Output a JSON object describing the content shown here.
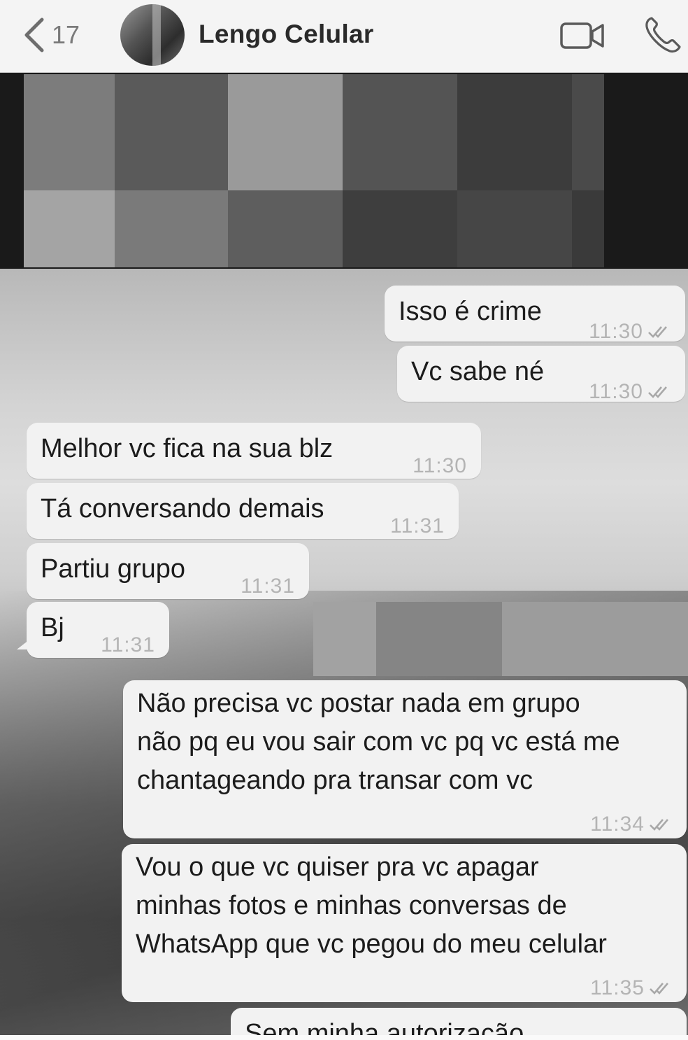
{
  "header": {
    "back_count": "17",
    "contact_name": "Lengo Celular"
  },
  "messages": [
    {
      "direction": "outgoing",
      "text": "Isso é crime",
      "time": "11:30",
      "read": true
    },
    {
      "direction": "outgoing",
      "text": "Vc sabe né",
      "time": "11:30",
      "read": true
    },
    {
      "direction": "incoming",
      "text": "Melhor vc fica na sua blz",
      "time": "11:30"
    },
    {
      "direction": "incoming",
      "text": "Tá conversando demais",
      "time": "11:31"
    },
    {
      "direction": "incoming",
      "text": "Partiu grupo",
      "time": "11:31"
    },
    {
      "direction": "incoming",
      "text": "Bj",
      "time": "11:31"
    },
    {
      "direction": "outgoing",
      "lines": [
        "Não precisa vc postar nada em grupo",
        "não pq eu vou sair com vc pq vc está me",
        "chantageando pra transar com vc"
      ],
      "time": "11:34",
      "read": true
    },
    {
      "direction": "outgoing",
      "lines": [
        "Vou o que vc quiser pra vc apagar",
        "minhas fotos e minhas conversas de",
        "WhatsApp que vc pegou do meu celular"
      ],
      "time": "11:35",
      "read": true
    },
    {
      "direction": "outgoing",
      "text": "Sem minha autorização",
      "partial": true
    }
  ]
}
